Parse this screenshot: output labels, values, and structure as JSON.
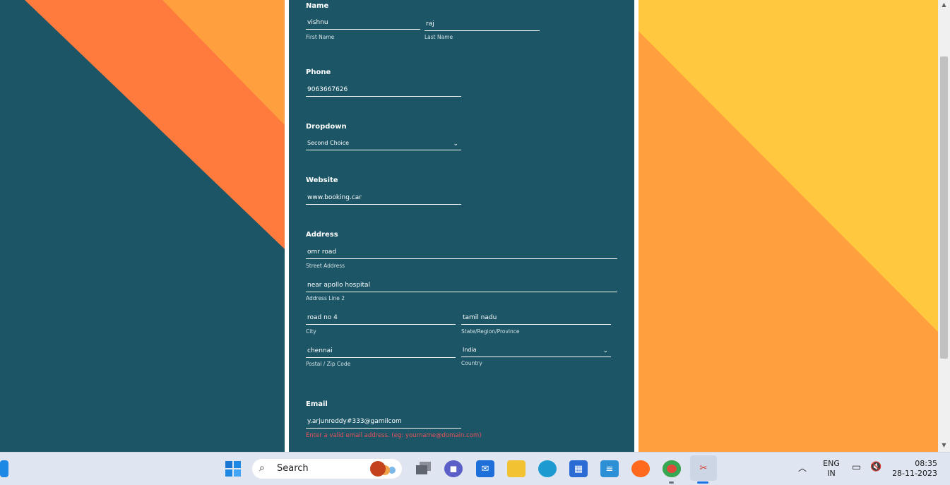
{
  "colors": {
    "form_bg": "#1b5566",
    "accent_orange": "#ff7a3d",
    "accent_amber": "#ff9f3e",
    "accent_yellow": "#ffc83e",
    "error_text": "#e8525a"
  },
  "form": {
    "name": {
      "label": "Name",
      "first_name_value": "vishnu",
      "first_name_sublabel": "First Name",
      "last_name_value": "raj",
      "last_name_sublabel": "Last Name"
    },
    "phone": {
      "label": "Phone",
      "value": "9063667626"
    },
    "dropdown": {
      "label": "Dropdown",
      "selected": "Second Choice"
    },
    "website": {
      "label": "Website",
      "value": "www.booking.car"
    },
    "address": {
      "label": "Address",
      "street_value": "omr road",
      "street_sublabel": "Street Address",
      "line2_value": "near apollo hospital",
      "line2_sublabel": "Address Line 2",
      "city_value": "road no 4",
      "city_sublabel": "City",
      "state_value": "tamil nadu",
      "state_sublabel": "State/Region/Province",
      "zip_value": "chennai",
      "zip_sublabel": "Postal / Zip Code",
      "country_selected": "India",
      "country_sublabel": "Country"
    },
    "email": {
      "label": "Email",
      "value": "y.arjunreddy#333@gamilcom",
      "error": "Enter a valid email address. (eg: yourname@domain.com)"
    }
  },
  "taskbar": {
    "search_label": "Search",
    "apps": [
      "windows-start-icon",
      "task-view-icon",
      "teams-chat-icon",
      "mail-icon",
      "file-explorer-icon",
      "edge-icon",
      "store-icon",
      "notepad-icon",
      "firefox-icon",
      "chrome-icon",
      "snipping-tool-icon"
    ],
    "language_line1": "ENG",
    "language_line2": "IN",
    "time": "08:35",
    "date": "28-11-2023"
  }
}
